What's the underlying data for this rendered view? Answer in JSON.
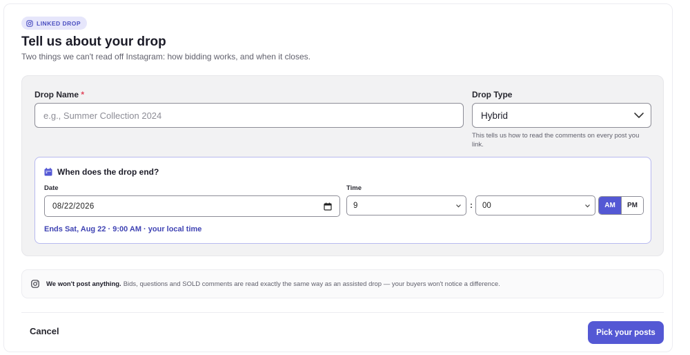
{
  "badge": {
    "label": "LINKED DROP",
    "icon": "instagram-icon"
  },
  "header": {
    "title": "Tell us about your drop",
    "subtitle": "Two things we can't read off Instagram: how bidding works, and when it closes."
  },
  "form": {
    "drop_name": {
      "label": "Drop Name",
      "required_mark": "*",
      "value": "",
      "placeholder": "e.g., Summer Collection 2024"
    },
    "drop_type": {
      "label": "Drop Type",
      "selected": "Hybrid",
      "hint": "This tells us how to read the comments on every post you link."
    },
    "end": {
      "heading": "When does the drop end?",
      "heading_icon": "calendar-icon",
      "date_label": "Date",
      "date_value": "08/22/2026",
      "time_label": "Time",
      "hour": "9",
      "separator": ":",
      "minute": "00",
      "am_label": "AM",
      "pm_label": "PM",
      "meridiem_selected": "AM",
      "summary": "Ends Sat, Aug 22 · 9:00 AM · your local time"
    }
  },
  "notice": {
    "icon": "instagram-icon",
    "strong": "We won't post anything.",
    "text": "Bids, questions and SOLD comments are read exactly the same way as an assisted drop — your buyers won't notice a difference."
  },
  "footer": {
    "cancel_label": "Cancel",
    "primary_label": "Pick your posts"
  },
  "colors": {
    "accent": "#5458d4",
    "accent_text": "#3f43b3",
    "badge_bg": "#e6e6fb",
    "required": "#e0445a"
  }
}
